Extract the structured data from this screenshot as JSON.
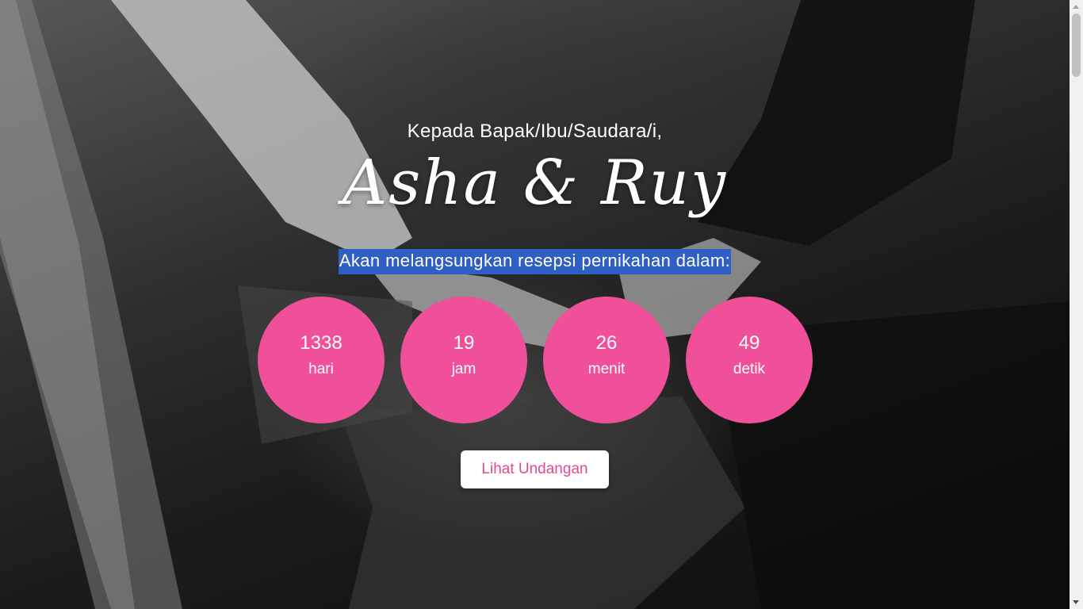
{
  "greeting": "Kepada Bapak/Ibu/Saudara/i,",
  "couple_names": "Asha & Ruy",
  "subtitle": "Akan melangsungkan resepsi pernikahan dalam:",
  "countdown": [
    {
      "value": "1338",
      "unit": "hari"
    },
    {
      "value": "19",
      "unit": "jam"
    },
    {
      "value": "26",
      "unit": "menit"
    },
    {
      "value": "49",
      "unit": "detik"
    }
  ],
  "cta_label": "Lihat Undangan",
  "colors": {
    "accent": "#f0509a",
    "cta_text": "#e8478f",
    "selection": "#2f5fc4"
  }
}
